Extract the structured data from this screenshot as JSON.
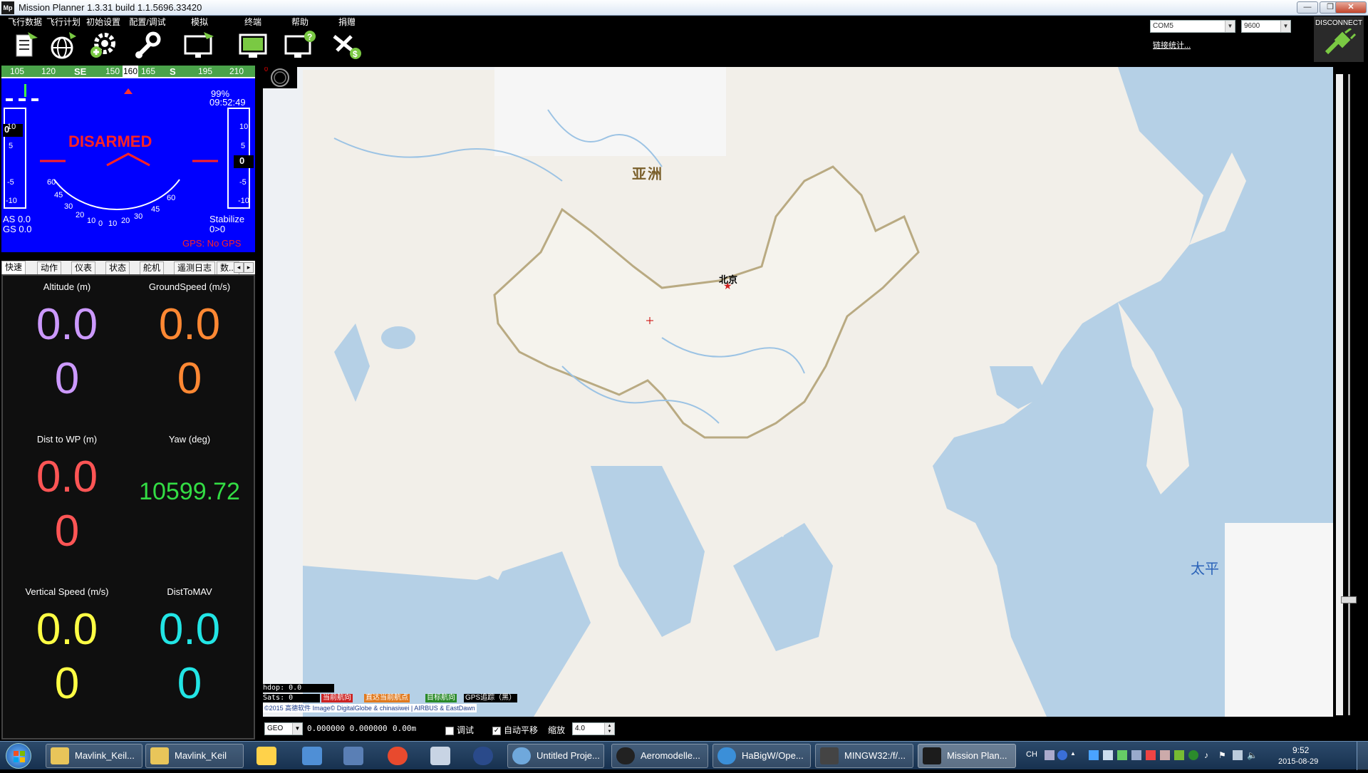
{
  "window": {
    "title": "Mission Planner 1.3.31 build 1.1.5696.33420",
    "logo_text": "Mp",
    "buttons": {
      "minimize": "—",
      "maximize": "❐",
      "close": "✕"
    }
  },
  "toolbar": {
    "items": [
      {
        "label": "飞行数据",
        "icon": "flight-data-icon"
      },
      {
        "label": "飞行计划",
        "icon": "flight-plan-globe-icon"
      },
      {
        "label": "初始设置",
        "icon": "initial-setup-gear-icon"
      },
      {
        "label": "配置/调试",
        "icon": "config-tuning-wrench-icon"
      },
      {
        "label": "模拟",
        "icon": "simulation-monitor-icon"
      },
      {
        "label": "终端",
        "icon": "terminal-monitor-icon"
      },
      {
        "label": "帮助",
        "icon": "help-monitor-icon"
      },
      {
        "label": "捐赠",
        "icon": "donate-plane-icon"
      }
    ],
    "port": "COM5",
    "baud": "9600",
    "link_stats": "链接统计...",
    "disconnect_label": "DISCONNECT"
  },
  "hud": {
    "heading_ticks": [
      "105",
      "120",
      "SE",
      "150",
      "165",
      "S",
      "195",
      "210"
    ],
    "heading_value": "160",
    "battery_pct": "99%",
    "time": "09:52:49",
    "status": "DISARMED",
    "left_scale": [
      "10",
      "5",
      "0",
      "-5",
      "-10"
    ],
    "right_scale": [
      "10",
      "5",
      "0",
      "-5",
      "-10"
    ],
    "left_value": "0",
    "right_value": "0",
    "roll_scale": [
      "60",
      "45",
      "30",
      "20",
      "10",
      "0",
      "10",
      "20",
      "30",
      "45",
      "60"
    ],
    "airspeed": "AS 0.0",
    "groundspeed": "GS 0.0",
    "mode": "Stabilize",
    "mode_sub": "0>0",
    "gps": "GPS: No GPS"
  },
  "tabs": [
    {
      "label": "快速",
      "active": true
    },
    {
      "label": "动作"
    },
    {
      "label": "仪表"
    },
    {
      "label": "状态"
    },
    {
      "label": "舵机"
    },
    {
      "label": "遥测日志"
    },
    {
      "label": "数..."
    }
  ],
  "quick": [
    {
      "label": "Altitude (m)",
      "value": "0.0",
      "sub": "0",
      "color": "#cc99ff"
    },
    {
      "label": "GroundSpeed (m/s)",
      "value": "0.0",
      "sub": "0",
      "color": "#ff8833"
    },
    {
      "label": "Dist to WP (m)",
      "value": "0.0",
      "sub": "0",
      "color": "#ff5555"
    },
    {
      "label": "Yaw (deg)",
      "value": "10599.72",
      "sub": "",
      "color": "#33dd44"
    },
    {
      "label": "Vertical Speed (m/s)",
      "value": "0.0",
      "sub": "0",
      "color": "#ffff44"
    },
    {
      "label": "DistToMAV",
      "value": "0.0",
      "sub": "0",
      "color": "#22e5e5"
    }
  ],
  "map": {
    "labels": {
      "asia": "亚洲",
      "beijing": "北京",
      "pacific": "太平"
    },
    "hdop": "hdop: 0.0",
    "sats": "Sats: 0",
    "legend": [
      {
        "label": "当前航向",
        "color": "#cc2222"
      },
      {
        "label": "直达当前航点",
        "color": "#e07a1f"
      },
      {
        "label": "目标航向",
        "color": "#2a8a2a"
      },
      {
        "label": "GPS追踪（黑）",
        "color": "#000000"
      }
    ],
    "copyright": "©2015 高德软件 Image© DigitalGlobe & chinasiwei | AIRBUS & EastDawn",
    "corner_marker": "0"
  },
  "bottom": {
    "coord_system": "GEO",
    "coords": "0.000000  0.000000",
    "alt": "0.00m",
    "debug_label": "调试",
    "debug_checked": false,
    "autopan_label": "自动平移",
    "autopan_checked": true,
    "zoom_label": "缩放",
    "zoom_value": "4.0"
  },
  "taskbar": {
    "tasks": [
      {
        "label": "Mavlink_Keil...",
        "color": "#e8c55a"
      },
      {
        "label": "Mavlink_Keil",
        "color": "#e8c55a"
      },
      {
        "label": "Untitled Proje...",
        "color": "#6fa8dc"
      },
      {
        "label": "Aeromodelle...",
        "color": "#222222"
      },
      {
        "label": "HaBigW/Ope...",
        "color": "#3b8fd8"
      },
      {
        "label": "MINGW32:/f/...",
        "color": "#444444"
      },
      {
        "label": "Mission Plan...",
        "color": "#1c1c1c"
      }
    ],
    "tray_lang": "CH",
    "clock_time": "9:52",
    "clock_date": "2015-08-29"
  }
}
